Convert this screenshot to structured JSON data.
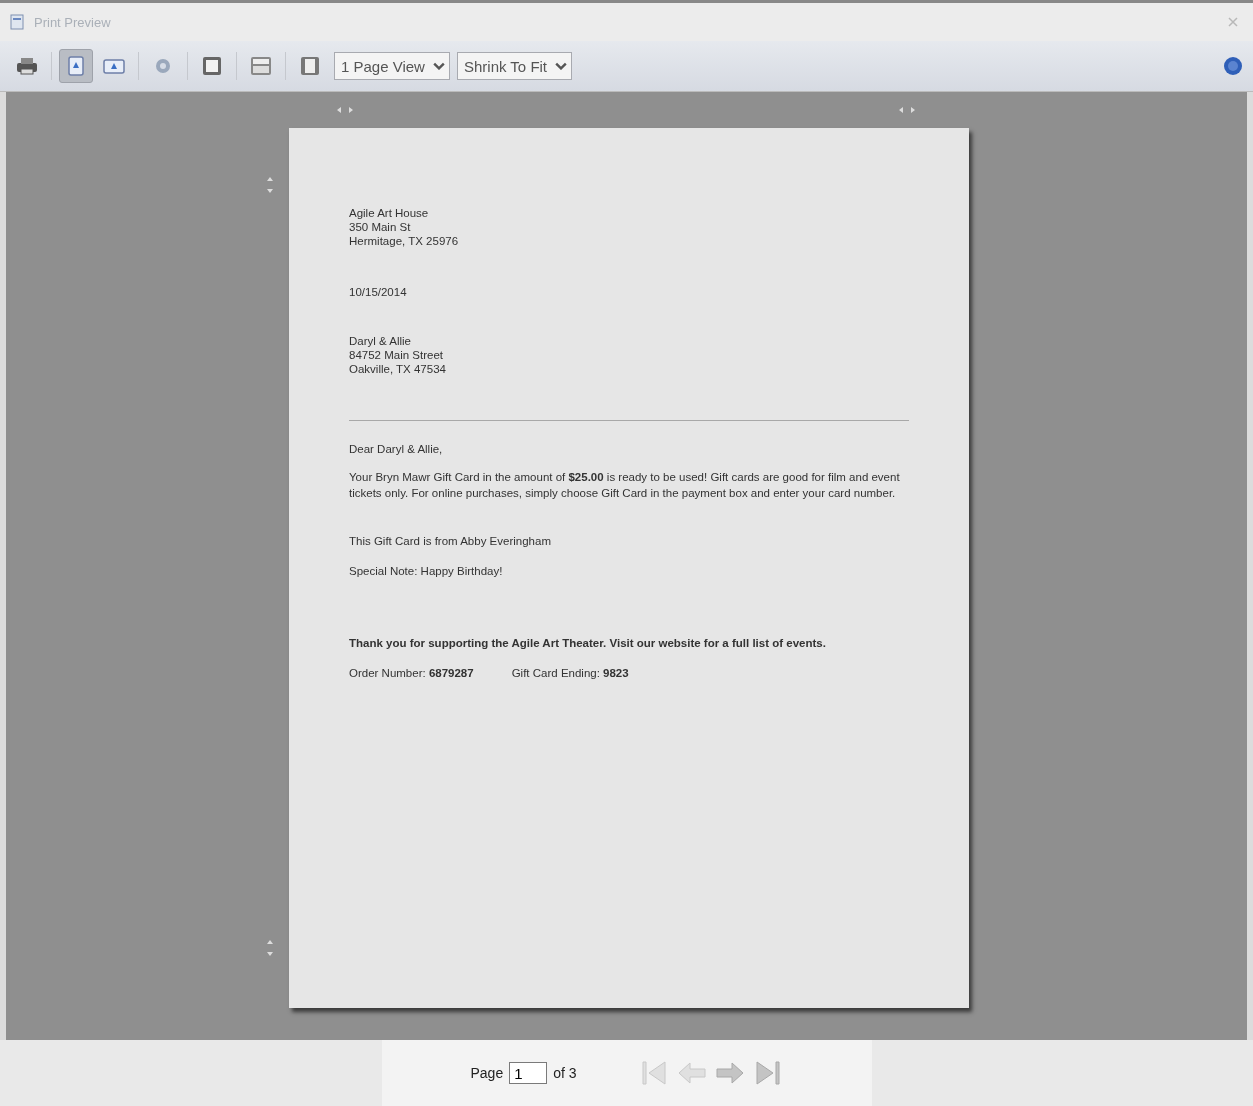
{
  "window": {
    "title": "Print Preview"
  },
  "toolbar": {
    "buttons": [
      {
        "kind": "print",
        "selected": false
      },
      {
        "kind": "portrait",
        "selected": true
      },
      {
        "kind": "landscape",
        "selected": false
      },
      {
        "kind": "options",
        "selected": false
      },
      {
        "kind": "margins",
        "selected": false
      },
      {
        "kind": "header",
        "selected": false
      },
      {
        "kind": "fullpage",
        "selected": false
      }
    ],
    "selects": [
      {
        "value": "1 Page View"
      },
      {
        "value": "Shrink To Fit"
      }
    ]
  },
  "letter": {
    "sender": [
      "Agile Art House",
      "350 Main St",
      "Hermitage, TX 25976"
    ],
    "date": "10/15/2014",
    "recipient": [
      "Daryl & Allie",
      "84752 Main Street",
      "Oakville, TX 47534"
    ],
    "greeting": "Dear Daryl & Allie,",
    "body": "Your Bryn Mawr Gift Card in the amount of **$25.00** is ready to be used! Gift cards are good for film and event tickets only. For online purchases, simply choose Gift Card in the payment box and enter your card number.",
    "from": "This Gift Card is from Abby Everingham",
    "note": "Special Note: Happy Birthday!",
    "thanks": "Thank you for supporting the Agile Art Theater. Visit our website for a full list of events.",
    "order": "Order Number: **6879287**",
    "card": "Gift Card Ending: **9823**"
  },
  "pager": {
    "label": "Page",
    "value": "1",
    "total": "of 3",
    "nav": [
      {
        "kind": "first",
        "disabled": true
      },
      {
        "kind": "prev",
        "disabled": true
      },
      {
        "kind": "next",
        "disabled": false
      },
      {
        "kind": "last",
        "disabled": false
      }
    ]
  }
}
